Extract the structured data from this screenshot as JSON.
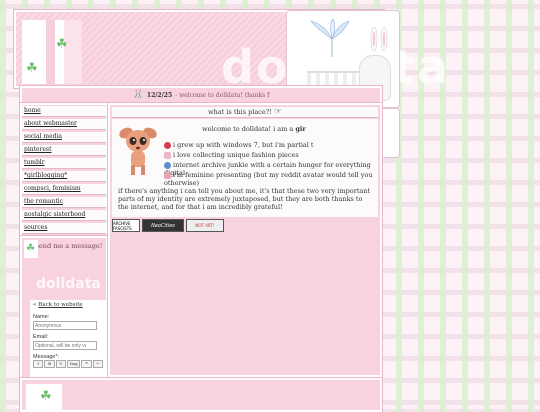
{
  "header": {
    "site_title": "dolldata"
  },
  "marquee": {
    "date": "12/2/25",
    "message": "- welcome to dolldata! thanks f"
  },
  "nav": {
    "items": [
      {
        "label": "home"
      },
      {
        "label": "about webmaster"
      },
      {
        "label": "social media"
      },
      {
        "label": "pinterest"
      },
      {
        "label": "tumblr"
      },
      {
        "label": "*girlblogging*"
      },
      {
        "label": "compsci, feminism"
      },
      {
        "label": "the romantic"
      },
      {
        "label": "nostalgic sisterhood"
      },
      {
        "label": "sources"
      }
    ]
  },
  "message_box": {
    "heading": "send me a message!",
    "watermark": "dolldata",
    "back_link": "Back to website",
    "back_prefix": "«",
    "name_label": "Name:",
    "name_placeholder": "Anonymous",
    "email_label": "Email:",
    "email_placeholder": "Optional, will be only vi",
    "message_label": "Message*:",
    "toolbar": [
      "I",
      "B",
      "U",
      "Img",
      "❝",
      "↶"
    ]
  },
  "main": {
    "title": "what is this place?!",
    "welcome_text": "welcome to dolldata! i am a",
    "welcome_bold": "gir",
    "facts": [
      {
        "text": "i grew up with windows 7, but i'm partial t",
        "icon_color": "#d83a4e"
      },
      {
        "text": "i love collecting unique fashion pieces",
        "icon_color": "#f1b6c6"
      },
      {
        "text": "internet archive junkie with a certain hunger for everything digital",
        "icon_color": "#5a8fd0"
      },
      {
        "text": "i'm feminine presenting (but my reddit avatar would tell you otherwise)",
        "icon_color": "#e9a2b8"
      }
    ],
    "paragraph": "if there's anything i can tell you about me, it's that these two very important parts of my identity are extremely juxtaposed, but they are both thanks to the internet, and for that i am incredibly grateful!",
    "buttons": [
      {
        "label": "ARCHIVE FASCISTS",
        "bg": "#ffffff",
        "fg": "#000000"
      },
      {
        "label": "NeoCities",
        "bg": "#333333",
        "fg": "#ffffff"
      },
      {
        "label": "NOT ART!",
        "bg": "#eeeeee",
        "fg": "#c0392b"
      }
    ]
  }
}
